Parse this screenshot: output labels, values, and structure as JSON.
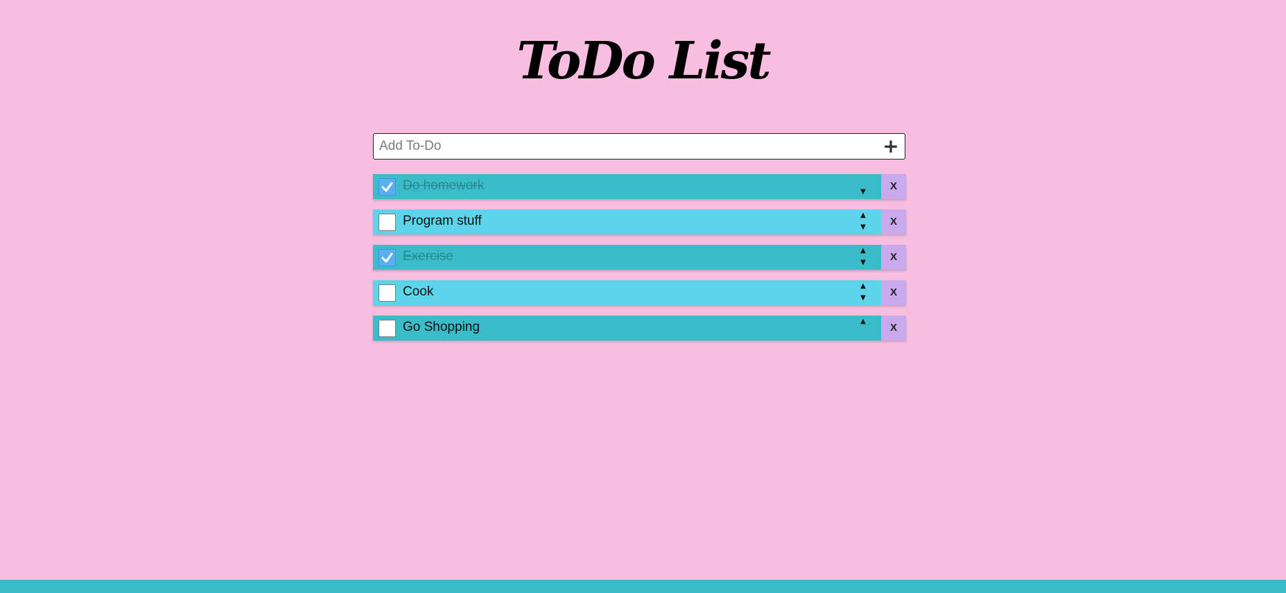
{
  "title": "ToDo List",
  "add": {
    "placeholder": "Add To-Do",
    "value": "",
    "button_label": "+"
  },
  "todos": [
    {
      "text": "Do homework",
      "done": true,
      "can_move_up": false,
      "can_move_down": true,
      "delete_label": "X"
    },
    {
      "text": "Program stuff",
      "done": false,
      "can_move_up": true,
      "can_move_down": true,
      "delete_label": "X"
    },
    {
      "text": "Exercise",
      "done": true,
      "can_move_up": true,
      "can_move_down": true,
      "delete_label": "X"
    },
    {
      "text": "Cook",
      "done": false,
      "can_move_up": true,
      "can_move_down": true,
      "delete_label": "X"
    },
    {
      "text": "Go Shopping",
      "done": false,
      "can_move_up": true,
      "can_move_down": false,
      "delete_label": "X"
    }
  ],
  "arrows": {
    "up": "▲",
    "down": "▼"
  },
  "colors": {
    "background": "#f8bedf",
    "row_dark": "#3abdc8",
    "row_light": "#5cd4e9",
    "delete": "#c8a9ee",
    "checkbox_checked": "#5aaff1",
    "footer": "#3abdc8"
  }
}
